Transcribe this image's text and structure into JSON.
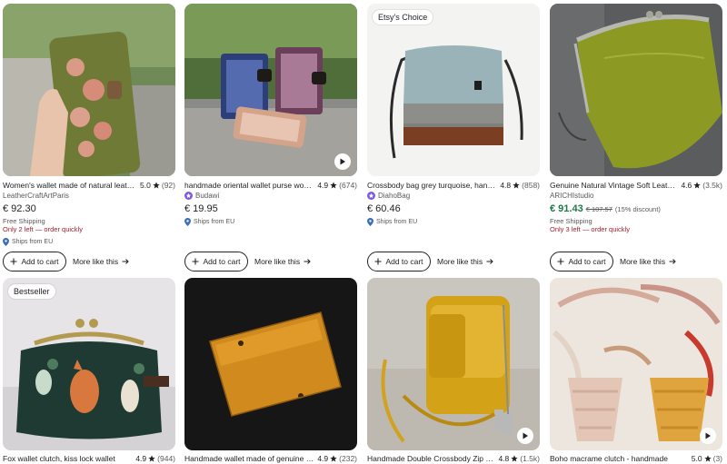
{
  "listings": [
    {
      "title": "Women's wallet made of natural leather",
      "rating": "5.0",
      "reviews": "(92)",
      "shop": "LeatherCraftArtParis",
      "price": "€ 92.30",
      "free_shipping": "Free Shipping",
      "stock": "Only 2 left — order quickly",
      "ships_from": "Ships from EU",
      "cart_label": "Add to cart",
      "more_label": "More like this"
    },
    {
      "title": "handmade oriental wallet purse women",
      "rating": "4.9",
      "reviews": "(674)",
      "shop": "Budawi",
      "price": "€ 19.95",
      "ships_from": "Ships from EU",
      "cart_label": "Add to cart",
      "more_label": "More like this"
    },
    {
      "badge": "Etsy's Choice",
      "title": "Crossbody bag grey turquoise, handmade",
      "rating": "4.8",
      "reviews": "(858)",
      "shop": "DiahoBag",
      "price": "€ 60.46",
      "ships_from": "Ships from EU",
      "cart_label": "Add to cart",
      "more_label": "More like this"
    },
    {
      "title": "Genuine Natural Vintage Soft Leather",
      "rating": "4.6",
      "reviews": "(3.5k)",
      "shop": "ARICHIstudio",
      "price": "€ 91.43",
      "orig_price": "€ 107.57",
      "discount": "(15% discount)",
      "free_shipping": "Free Shipping",
      "stock": "Only 3 left — order quickly",
      "cart_label": "Add to cart",
      "more_label": "More like this"
    },
    {
      "badge": "Bestseller",
      "title": "Fox wallet clutch, kiss lock wallet",
      "rating": "4.9",
      "reviews": "(944)"
    },
    {
      "title": "Handmade wallet made of genuine leather",
      "rating": "4.9",
      "reviews": "(232)"
    },
    {
      "title": "Handmade Double Crossbody Zip Bag",
      "rating": "4.8",
      "reviews": "(1.5k)"
    },
    {
      "title": "Boho macrame clutch - handmade",
      "rating": "5.0",
      "reviews": "(3)"
    }
  ],
  "icons": {
    "star": "star-icon",
    "play": "play-icon",
    "plus": "plus-icon",
    "arrow": "arrow-right-icon",
    "pin": "location-pin-icon",
    "star_seller": "star-seller-icon"
  },
  "colors": {
    "sale_price": "#1e7a46",
    "low_stock": "#a61a2e",
    "star_seller": "#7f5ae0"
  }
}
